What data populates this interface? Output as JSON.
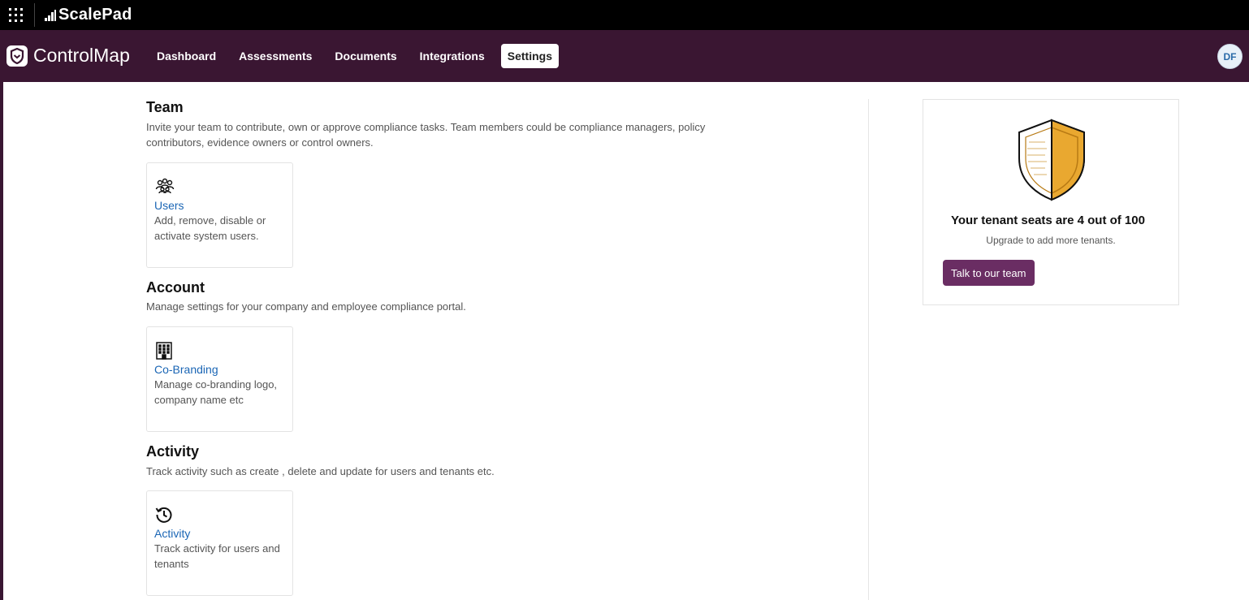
{
  "topbar": {
    "brand": "ScalePad"
  },
  "navbar": {
    "brand": "ControlMap",
    "items": [
      {
        "label": "Dashboard",
        "active": false
      },
      {
        "label": "Assessments",
        "active": false
      },
      {
        "label": "Documents",
        "active": false
      },
      {
        "label": "Integrations",
        "active": false
      },
      {
        "label": "Settings",
        "active": true
      }
    ],
    "avatar_initials": "DF"
  },
  "sections": {
    "team": {
      "title": "Team",
      "description": "Invite your team to contribute, own or approve compliance tasks. Team members could be compliance managers, policy contributors, evidence owners or control owners.",
      "card": {
        "icon": "users-group-icon",
        "title": "Users",
        "description": "Add, remove, disable or activate system users."
      }
    },
    "account": {
      "title": "Account",
      "description": "Manage settings for your company and employee compliance portal.",
      "card": {
        "icon": "building-icon",
        "title": "Co-Branding",
        "description": "Manage co-branding logo, company name etc"
      }
    },
    "activity": {
      "title": "Activity",
      "description": "Track activity such as create , delete and update for users and tenants etc.",
      "card": {
        "icon": "history-icon",
        "title": "Activity",
        "description": "Track activity for users and tenants"
      }
    }
  },
  "side_panel": {
    "seats_text": "Your tenant seats are 4 out of 100",
    "upgrade_text": "Upgrade to add more tenants.",
    "button_label": "Talk to our team"
  },
  "colors": {
    "nav_bg": "#3a1632",
    "link": "#1b66b5",
    "button_bg": "#6a2d63",
    "shield_gold": "#e9a830"
  }
}
